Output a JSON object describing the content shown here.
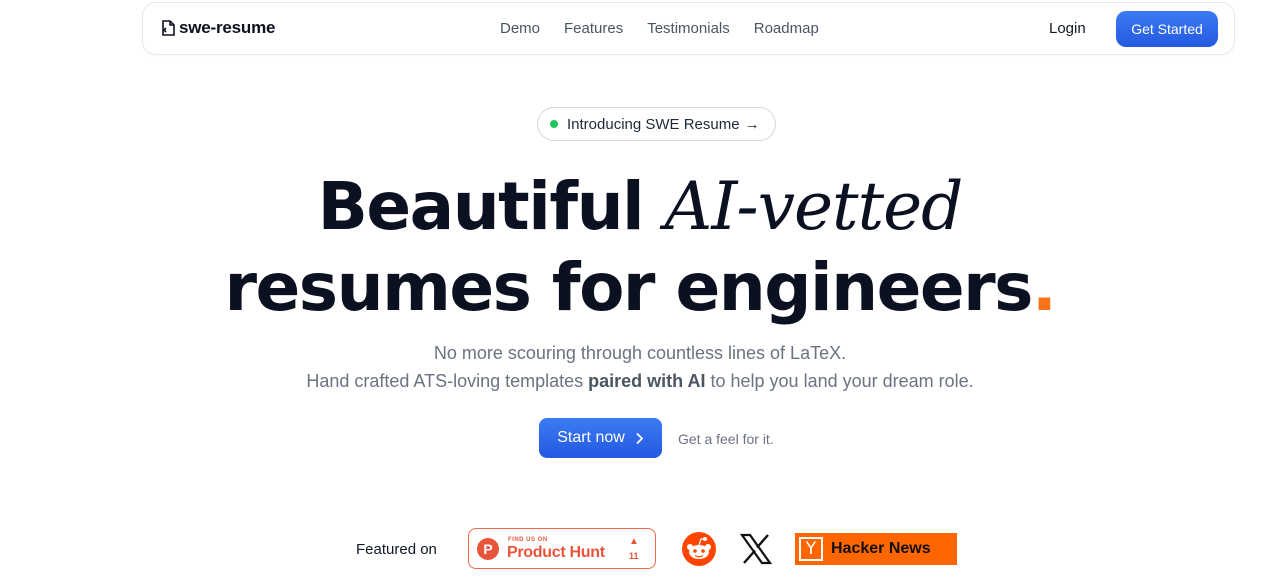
{
  "nav": {
    "logo": "swe-resume",
    "links": [
      "Demo",
      "Features",
      "Testimonials",
      "Roadmap"
    ],
    "login": "Login",
    "cta": "Get Started"
  },
  "pill": {
    "text": "Introducing SWE Resume",
    "arrow": "→"
  },
  "hero": {
    "line1_a": "Beautiful ",
    "line1_b": "AI-vetted",
    "line2": "resumes for engineers",
    "line2_dot": ".",
    "sub1": "No more scouring through countless lines of LaTeX.",
    "sub2_a": "Hand crafted ATS-loving templates ",
    "sub2_b": "paired with AI",
    "sub2_c": " to help you land your dream role.",
    "start": "Start now",
    "feel": "Get a feel for it."
  },
  "featured": {
    "label": "Featured on",
    "ph_small": "FIND US ON",
    "ph_big": "Product Hunt",
    "ph_letter": "P",
    "ph_count": "11",
    "hn_y": "Y",
    "hn_text": "Hacker News"
  },
  "colors": {
    "accent": "#2563eb",
    "dot": "#f97316",
    "ph": "#e9553b",
    "hn": "#ff6600",
    "green": "#22c55e"
  }
}
